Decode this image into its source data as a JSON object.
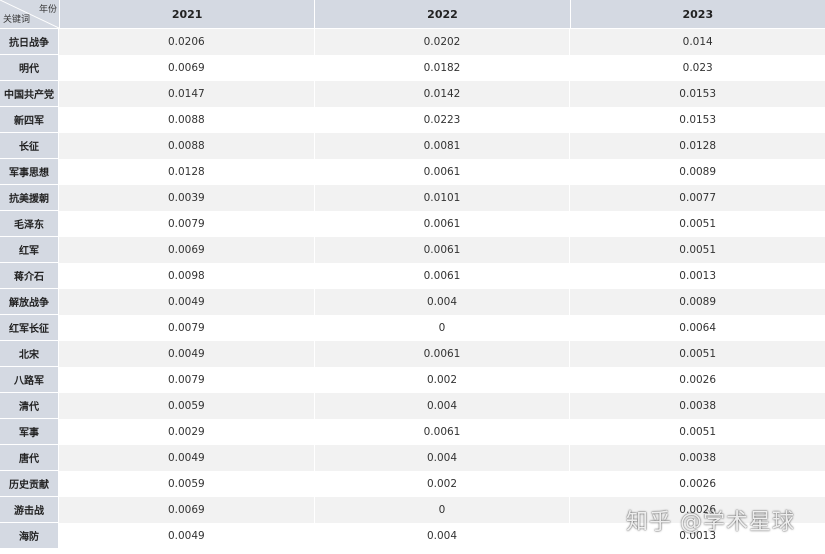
{
  "table": {
    "corner_top": "年份",
    "corner_bottom": "关键词",
    "columns": [
      "2021",
      "2022",
      "2023"
    ],
    "rows": [
      {
        "label": "抗日战争",
        "values": [
          "0.0206",
          "0.0202",
          "0.014"
        ]
      },
      {
        "label": "明代",
        "values": [
          "0.0069",
          "0.0182",
          "0.023"
        ]
      },
      {
        "label": "中国共产党",
        "values": [
          "0.0147",
          "0.0142",
          "0.0153"
        ]
      },
      {
        "label": "新四军",
        "values": [
          "0.0088",
          "0.0223",
          "0.0153"
        ]
      },
      {
        "label": "长征",
        "values": [
          "0.0088",
          "0.0081",
          "0.0128"
        ]
      },
      {
        "label": "军事思想",
        "values": [
          "0.0128",
          "0.0061",
          "0.0089"
        ]
      },
      {
        "label": "抗美援朝",
        "values": [
          "0.0039",
          "0.0101",
          "0.0077"
        ]
      },
      {
        "label": "毛泽东",
        "values": [
          "0.0079",
          "0.0061",
          "0.0051"
        ]
      },
      {
        "label": "红军",
        "values": [
          "0.0069",
          "0.0061",
          "0.0051"
        ]
      },
      {
        "label": "蒋介石",
        "values": [
          "0.0098",
          "0.0061",
          "0.0013"
        ]
      },
      {
        "label": "解放战争",
        "values": [
          "0.0049",
          "0.004",
          "0.0089"
        ]
      },
      {
        "label": "红军长征",
        "values": [
          "0.0079",
          "0",
          "0.0064"
        ]
      },
      {
        "label": "北宋",
        "values": [
          "0.0049",
          "0.0061",
          "0.0051"
        ]
      },
      {
        "label": "八路军",
        "values": [
          "0.0079",
          "0.002",
          "0.0026"
        ]
      },
      {
        "label": "清代",
        "values": [
          "0.0059",
          "0.004",
          "0.0038"
        ]
      },
      {
        "label": "军事",
        "values": [
          "0.0029",
          "0.0061",
          "0.0051"
        ]
      },
      {
        "label": "唐代",
        "values": [
          "0.0049",
          "0.004",
          "0.0038"
        ]
      },
      {
        "label": "历史贡献",
        "values": [
          "0.0059",
          "0.002",
          "0.0026"
        ]
      },
      {
        "label": "游击战",
        "values": [
          "0.0069",
          "0",
          "0.0026"
        ]
      },
      {
        "label": "海防",
        "values": [
          "0.0049",
          "0.004",
          "0.0013"
        ]
      }
    ]
  },
  "watermark": "知乎 @学术星球"
}
